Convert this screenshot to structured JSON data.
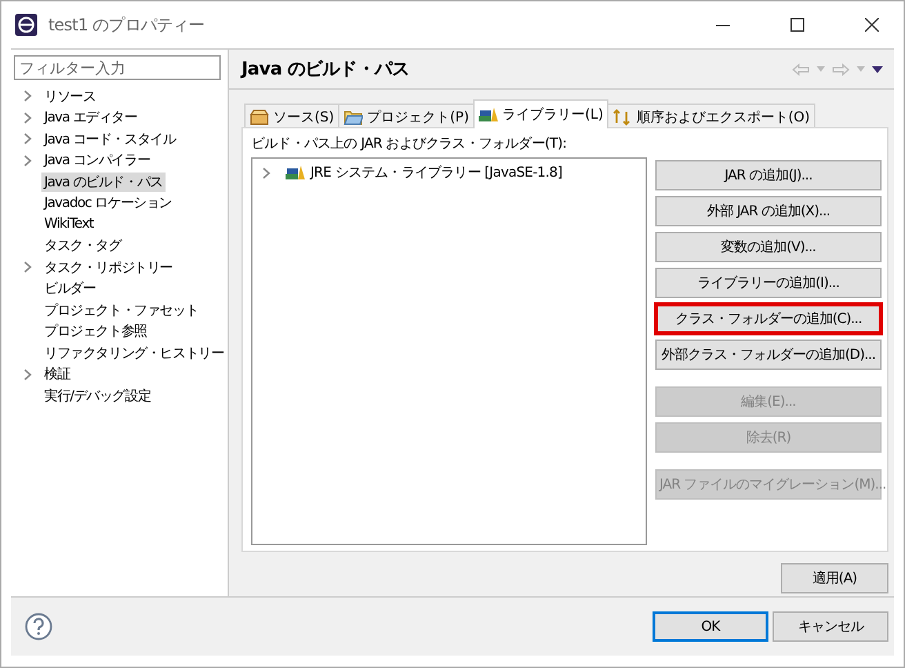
{
  "window": {
    "title": "test1 のプロパティー"
  },
  "filter": {
    "placeholder": "フィルター入力"
  },
  "nav_items": [
    {
      "label": "リソース",
      "expandable": true,
      "selected": false
    },
    {
      "label": "Java エディター",
      "expandable": true,
      "selected": false
    },
    {
      "label": "Java コード・スタイル",
      "expandable": true,
      "selected": false
    },
    {
      "label": "Java コンパイラー",
      "expandable": true,
      "selected": false
    },
    {
      "label": "Java のビルド・パス",
      "expandable": false,
      "selected": true
    },
    {
      "label": "Javadoc ロケーション",
      "expandable": false,
      "selected": false
    },
    {
      "label": "WikiText",
      "expandable": false,
      "selected": false
    },
    {
      "label": "タスク・タグ",
      "expandable": false,
      "selected": false
    },
    {
      "label": "タスク・リポジトリー",
      "expandable": true,
      "selected": false
    },
    {
      "label": "ビルダー",
      "expandable": false,
      "selected": false
    },
    {
      "label": "プロジェクト・ファセット",
      "expandable": false,
      "selected": false
    },
    {
      "label": "プロジェクト参照",
      "expandable": false,
      "selected": false
    },
    {
      "label": "リファクタリング・ヒストリー",
      "expandable": false,
      "selected": false
    },
    {
      "label": "検証",
      "expandable": true,
      "selected": false
    },
    {
      "label": "実行/デバッグ設定",
      "expandable": false,
      "selected": false
    }
  ],
  "page_title": "Java のビルド・パス",
  "tabs": [
    {
      "label": "ソース(S)",
      "kind": "source",
      "selected": false
    },
    {
      "label": "プロジェクト(P)",
      "kind": "project",
      "selected": false
    },
    {
      "label": "ライブラリー(L)",
      "kind": "library",
      "selected": true
    },
    {
      "label": "順序およびエクスポート(O)",
      "kind": "order",
      "selected": false
    }
  ],
  "list_label": "ビルド・パス上の JAR およびクラス・フォルダー(T):",
  "entries": [
    {
      "label": "JRE システム・ライブラリー [JavaSE-1.8]",
      "expandable": true
    }
  ],
  "button_groups": [
    [
      {
        "label": "JAR の追加(J)...",
        "disabled": false,
        "highlighted": false
      },
      {
        "label": "外部 JAR の追加(X)...",
        "disabled": false,
        "highlighted": false
      },
      {
        "label": "変数の追加(V)...",
        "disabled": false,
        "highlighted": false
      },
      {
        "label": "ライブラリーの追加(I)...",
        "disabled": false,
        "highlighted": false
      },
      {
        "label": "クラス・フォルダーの追加(C)...",
        "disabled": false,
        "highlighted": true
      },
      {
        "label": "外部クラス・フォルダーの追加(D)...",
        "disabled": false,
        "highlighted": false
      }
    ],
    [
      {
        "label": "編集(E)...",
        "disabled": true,
        "highlighted": false
      },
      {
        "label": "除去(R)",
        "disabled": true,
        "highlighted": false
      }
    ],
    [
      {
        "label": "JAR ファイルのマイグレーション(M)...",
        "disabled": true,
        "highlighted": false
      }
    ]
  ],
  "apply_button": "適用(A)",
  "footer_buttons": [
    {
      "label": "OK",
      "default": true
    },
    {
      "label": "キャンセル",
      "default": false
    }
  ]
}
